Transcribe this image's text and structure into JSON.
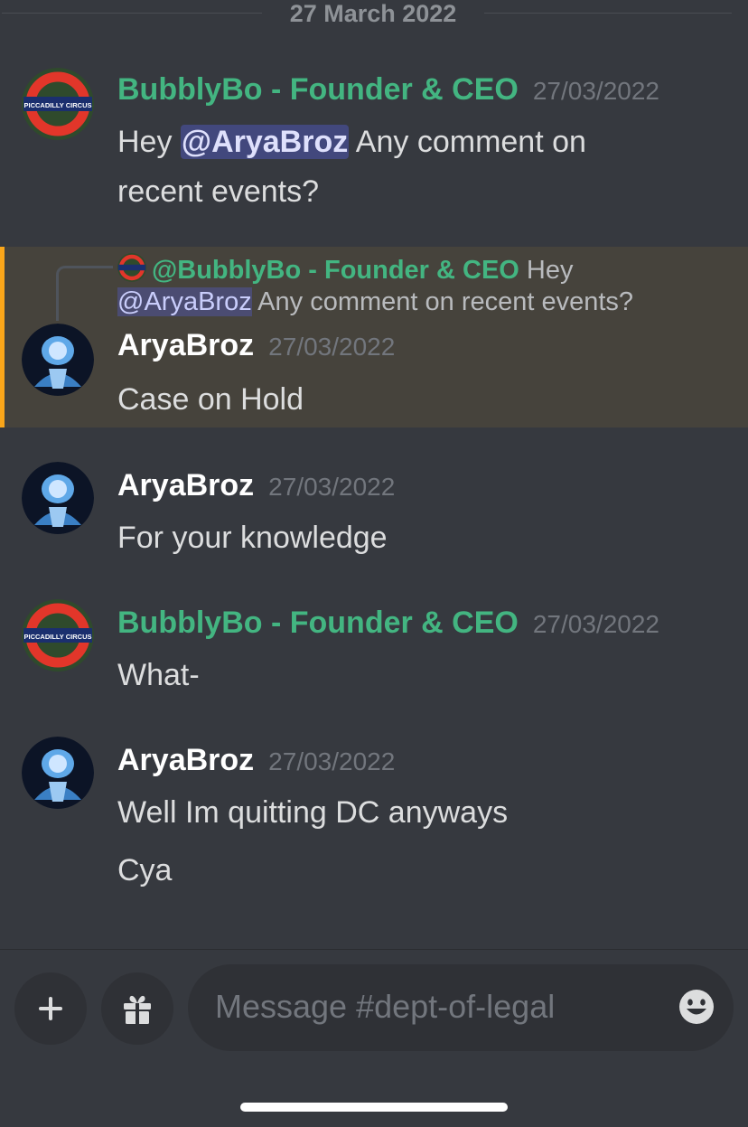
{
  "date_divider": "27 March 2022",
  "avatar_text": "PICCADILLY CIRCUS",
  "messages": [
    {
      "author": "BubblyBo - Founder & CEO",
      "timestamp": "27/03/2022",
      "pre": "Hey ",
      "mention": "@AryaBroz",
      "post": " Any comment on",
      "line2": "recent events?"
    },
    {
      "reply": {
        "author": "@BubblyBo - Founder & CEO",
        "text_pre": " Hey",
        "mention": "@AryaBroz",
        "text_post": " Any comment on recent events?"
      },
      "author": "AryaBroz",
      "timestamp": "27/03/2022",
      "text": "Case on Hold"
    },
    {
      "author": "AryaBroz",
      "timestamp": "27/03/2022",
      "text": "For your knowledge"
    },
    {
      "author": "BubblyBo - Founder & CEO",
      "timestamp": "27/03/2022",
      "text": "What-"
    },
    {
      "author": "AryaBroz",
      "timestamp": "27/03/2022",
      "lines": [
        "Well Im quitting DC anyways",
        "Cya"
      ]
    }
  ],
  "composer": {
    "placeholder": "Message #dept-of-legal",
    "add_icon": "plus-icon",
    "gift_icon": "gift-icon",
    "emoji_icon": "emoji-icon"
  },
  "colors": {
    "background": "#36393f",
    "founder_name": "#43b581",
    "reply_highlight": "#46433c",
    "reply_bar": "#faa61a"
  }
}
